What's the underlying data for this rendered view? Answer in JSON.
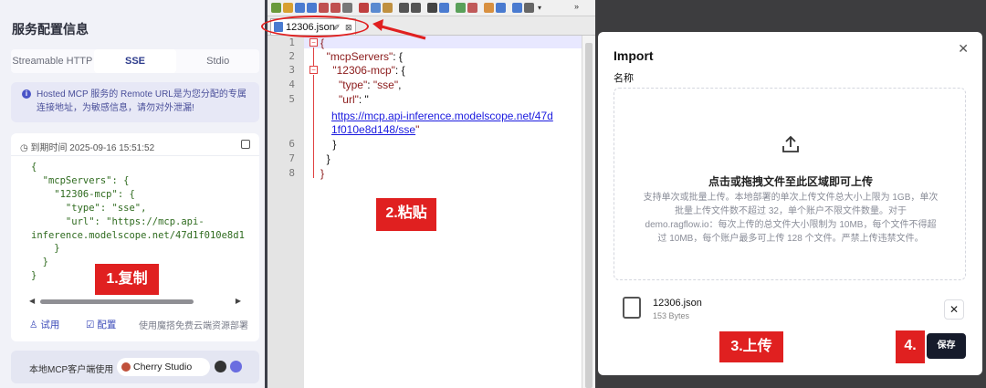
{
  "left_panel": {
    "title": "服务配置信息",
    "tabs": [
      "Streamable HTTP",
      "SSE",
      "Stdio"
    ],
    "active_tab": "SSE",
    "notice": "Hosted MCP 服务的 Remote URL是为您分配的专属连接地址，为敏感信息，请勿对外泄漏!",
    "expiry": "到期时间 2025-09-16 15:51:52",
    "code": "{\n  \"mcpServers\": {\n    \"12306-mcp\": {\n      \"type\": \"sse\",\n      \"url\": \"https://mcp.api-\ninference.modelscope.net/47d1f010e8d1\n    }\n  }\n}",
    "footer": {
      "try_label": "试用",
      "config_label": "配置",
      "deploy_text": "使用魔搭免费云端资源部署"
    },
    "client_bar": {
      "label": "本地MCP客户端使用",
      "chip": "Cherry Studio"
    }
  },
  "editor": {
    "file_tab": "12306.json",
    "line_numbers": [
      "1",
      "2",
      "3",
      "4",
      "5",
      "6",
      "7",
      "8"
    ],
    "lines": {
      "l1": "{",
      "l2_key": "\"mcpServers\"",
      "l2_rest": ": {",
      "l3_key": "\"12306-mcp\"",
      "l3_rest": ": {",
      "l4_key": "\"type\"",
      "l4_mid": ": ",
      "l4_val": "\"sse\"",
      "l4_end": ",",
      "l5_key": "\"url\"",
      "l5_mid": ": \"",
      "l5_url1": "https://mcp.api-inference.modelscope.net/47d",
      "l5_url2": "1f010e8d148/sse",
      "l5_end": "\"",
      "l6": "}",
      "l7": "}",
      "l8": "}"
    }
  },
  "annotations": {
    "step1": "1.复制",
    "step2": "2.粘贴",
    "step3": "3.上传",
    "step4": "4."
  },
  "dialog": {
    "title": "Import",
    "label": "名称",
    "dropzone_title": "点击或拖拽文件至此区域即可上传",
    "dropzone_desc": "支持单次或批量上传。本地部署的单次上传文件总大小上限为 1GB，单次批量上传文件数不超过 32，单个账户不限文件数量。对于 demo.ragflow.io：每次上传的总文件大小限制为 10MB，每个文件不得超过 10MB，每个账户最多可上传 128 个文件。严禁上传违禁文件。",
    "file_name": "12306.json",
    "file_size": "153 Bytes",
    "save_label": "保存"
  }
}
